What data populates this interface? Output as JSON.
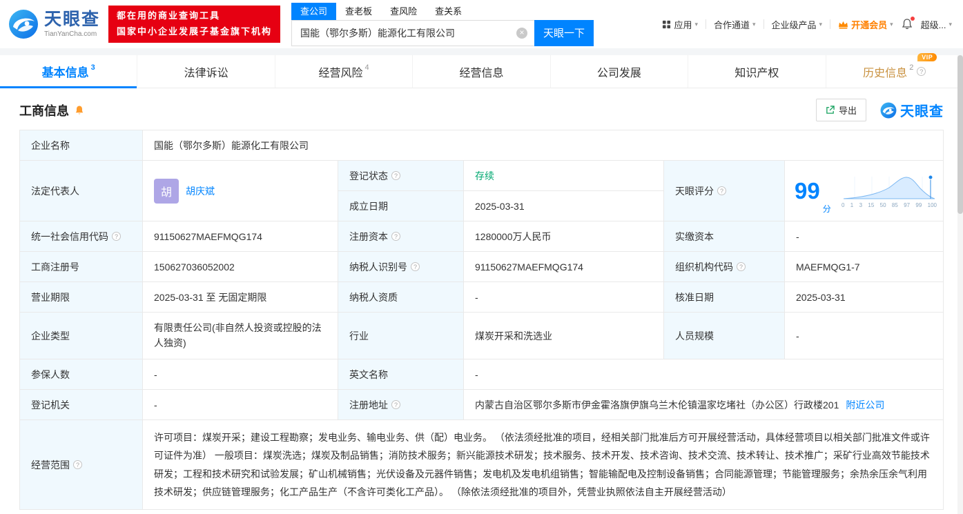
{
  "header": {
    "logo": {
      "name": "天眼查",
      "domain": "TianYanCha.com"
    },
    "promo": {
      "line1": "都在用的商业查询工具",
      "line2": "国家中小企业发展子基金旗下机构"
    },
    "search": {
      "tabs": [
        "查公司",
        "查老板",
        "查风险",
        "查关系"
      ],
      "value": "国能（鄂尔多斯）能源化工有限公司",
      "button": "天眼一下"
    },
    "nav": {
      "items": [
        "应用",
        "合作通道",
        "企业级产品",
        "开通会员",
        "超级..."
      ]
    }
  },
  "tabs": {
    "items": [
      {
        "label": "基本信息",
        "count": "3"
      },
      {
        "label": "法律诉讼",
        "count": ""
      },
      {
        "label": "经营风险",
        "count": "4"
      },
      {
        "label": "经营信息",
        "count": ""
      },
      {
        "label": "公司发展",
        "count": ""
      },
      {
        "label": "知识产权",
        "count": ""
      },
      {
        "label": "历史信息",
        "count": "2",
        "badge": "VIP"
      }
    ]
  },
  "section": {
    "title": "工商信息",
    "export": "导出",
    "brand": "天眼查"
  },
  "table": {
    "company_name": {
      "label": "企业名称",
      "value": "国能（鄂尔多斯）能源化工有限公司"
    },
    "legal_rep": {
      "label": "法定代表人",
      "avatar": "胡",
      "name": "胡庆斌"
    },
    "reg_status": {
      "label": "登记状态",
      "value": "存续"
    },
    "establish_date": {
      "label": "成立日期",
      "value": "2025-03-31"
    },
    "score": {
      "label": "天眼评分",
      "value": "99",
      "unit": "分",
      "ticks": [
        "0",
        "1",
        "3",
        "15",
        "50",
        "85",
        "97",
        "99",
        "100"
      ]
    },
    "credit_code": {
      "label": "统一社会信用代码",
      "value": "91150627MAEFMQG174"
    },
    "reg_capital": {
      "label": "注册资本",
      "value": "1280000万人民币"
    },
    "paid_capital": {
      "label": "实缴资本",
      "value": "-"
    },
    "reg_number": {
      "label": "工商注册号",
      "value": "150627036052002"
    },
    "taxpayer_id": {
      "label": "纳税人识别号",
      "value": "91150627MAEFMQG174"
    },
    "org_code": {
      "label": "组织机构代码",
      "value": "MAEFMQG1-7"
    },
    "business_term": {
      "label": "营业期限",
      "value": "2025-03-31 至 无固定期限"
    },
    "taxpayer_quality": {
      "label": "纳税人资质",
      "value": "-"
    },
    "approval_date": {
      "label": "核准日期",
      "value": "2025-03-31"
    },
    "company_type": {
      "label": "企业类型",
      "value": "有限责任公司(非自然人投资或控股的法人独资)"
    },
    "industry": {
      "label": "行业",
      "value": "煤炭开采和洗选业"
    },
    "staff_size": {
      "label": "人员规模",
      "value": "-"
    },
    "insured_count": {
      "label": "参保人数",
      "value": "-"
    },
    "english_name": {
      "label": "英文名称",
      "value": "-"
    },
    "reg_authority": {
      "label": "登记机关",
      "value": "-"
    },
    "reg_address": {
      "label": "注册地址",
      "value": "内蒙古自治区鄂尔多斯市伊金霍洛旗伊旗乌兰木伦镇温家圪堵社（办公区）行政楼201",
      "link": "附近公司"
    },
    "business_scope": {
      "label": "经营范围",
      "value": "许可项目：煤炭开采；建设工程勘察；发电业务、输电业务、供（配）电业务。 （依法须经批准的项目，经相关部门批准后方可开展经营活动，具体经营项目以相关部门批准文件或许可证件为准） 一般项目：煤炭洗选；煤炭及制品销售；消防技术服务；新兴能源技术研发；技术服务、技术开发、技术咨询、技术交流、技术转让、技术推广；采矿行业高效节能技术研发；工程和技术研究和试验发展；矿山机械销售；光伏设备及元器件销售；发电机及发电机组销售；智能输配电及控制设备销售；合同能源管理；节能管理服务；余热余压余气利用技术研发；供应链管理服务；化工产品生产（不含许可类化工产品）。 （除依法须经批准的项目外，凭营业执照依法自主开展经营活动）"
    }
  }
}
